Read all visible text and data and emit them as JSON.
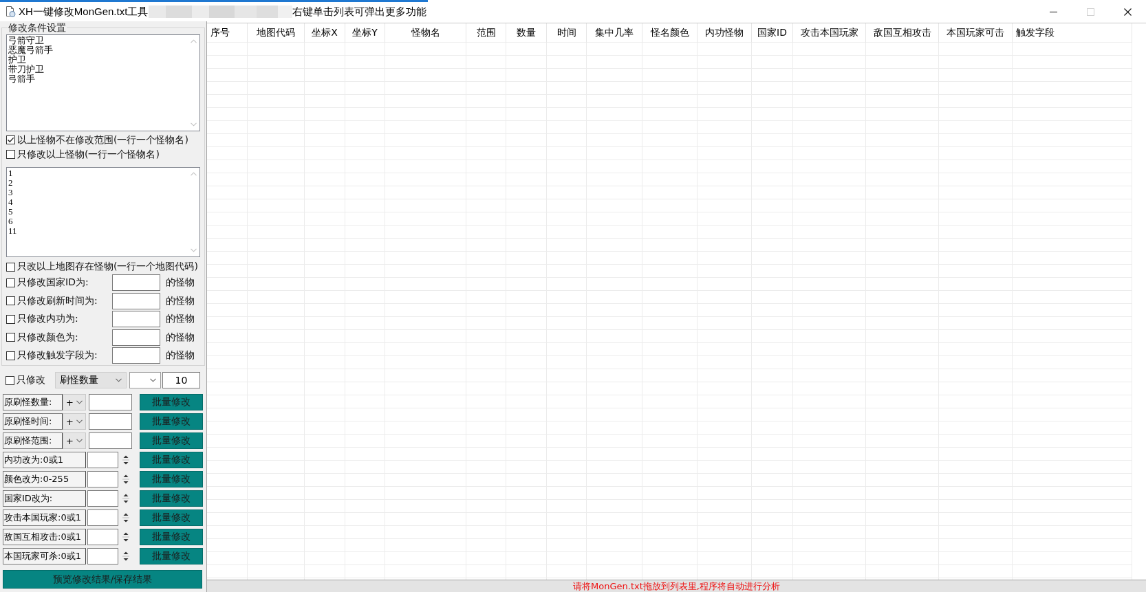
{
  "window": {
    "title": "XH一键修改MonGen.txt工具",
    "hint": "右键单击列表可弹出更多功能",
    "controls": [
      {
        "kind": "minimize",
        "disabled": false
      },
      {
        "kind": "maximize",
        "disabled": true
      },
      {
        "kind": "close",
        "disabled": false
      }
    ]
  },
  "conditions": {
    "group_title": "修改条件设置",
    "excluded_monsters": [
      "弓箭守卫",
      "恶魔弓箭手",
      "护卫",
      "带刀护卫",
      "弓箭手"
    ],
    "monster_checks": [
      {
        "label": "以上怪物不在修改范围(一行一个怪物名)",
        "checked": true
      },
      {
        "label": "只修改以上怪物(一行一个怪物名)",
        "checked": false
      }
    ],
    "map_codes": [
      "1",
      "2",
      "3",
      "4",
      "5",
      "6",
      "11"
    ],
    "map_check": {
      "label": "只改以上地图存在怪物(一行一个地图代码)",
      "checked": false
    },
    "filters": [
      {
        "label": "只修改国家ID为:",
        "checked": false,
        "suffix": "的怪物"
      },
      {
        "label": "只修改刷新时间为:",
        "checked": false,
        "suffix": "的怪物"
      },
      {
        "label": "只修改内功为:",
        "checked": false,
        "suffix": "的怪物"
      },
      {
        "label": "只修改颜色为:",
        "checked": false,
        "suffix": "的怪物"
      },
      {
        "label": "只修改触发字段为:",
        "checked": false,
        "suffix": "的怪物"
      }
    ]
  },
  "only_modify": {
    "label": "只修改",
    "checked": false,
    "field": "刷怪数量",
    "value": "10"
  },
  "batch_rows": [
    {
      "kind": "operator",
      "label": "原刷怪数量:",
      "operator": "+",
      "button": "批量修改"
    },
    {
      "kind": "operator",
      "label": "原刷怪时间:",
      "operator": "+",
      "button": "批量修改"
    },
    {
      "kind": "operator",
      "label": "原刷怪范围:",
      "operator": "+",
      "button": "批量修改"
    },
    {
      "kind": "spin",
      "label": "内功改为:0或1",
      "button": "批量修改"
    },
    {
      "kind": "spin",
      "label": "颜色改为:0-255",
      "button": "批量修改"
    },
    {
      "kind": "spin",
      "label": "国家ID改为:",
      "button": "批量修改"
    },
    {
      "kind": "spin",
      "label": "攻击本国玩家:0或1",
      "button": "批量修改"
    },
    {
      "kind": "spin",
      "label": "敌国互相攻击:0或1",
      "button": "批量修改"
    },
    {
      "kind": "spin",
      "label": "本国玩家可杀:0或1",
      "button": "批量修改"
    }
  ],
  "preview_button": "预览修改结果/保存结果",
  "table": {
    "columns": [
      "序号",
      "地图代码",
      "坐标X",
      "坐标Y",
      "怪物名",
      "范围",
      "数量",
      "时间",
      "集中几率",
      "怪名颜色",
      "内功怪物",
      "国家ID",
      "攻击本国玩家",
      "敌国互相攻击",
      "本国玩家可击",
      "触发字段"
    ]
  },
  "status_bar": {
    "message": "请将MonGen.txt拖放到列表里,程序将自动进行分析"
  }
}
